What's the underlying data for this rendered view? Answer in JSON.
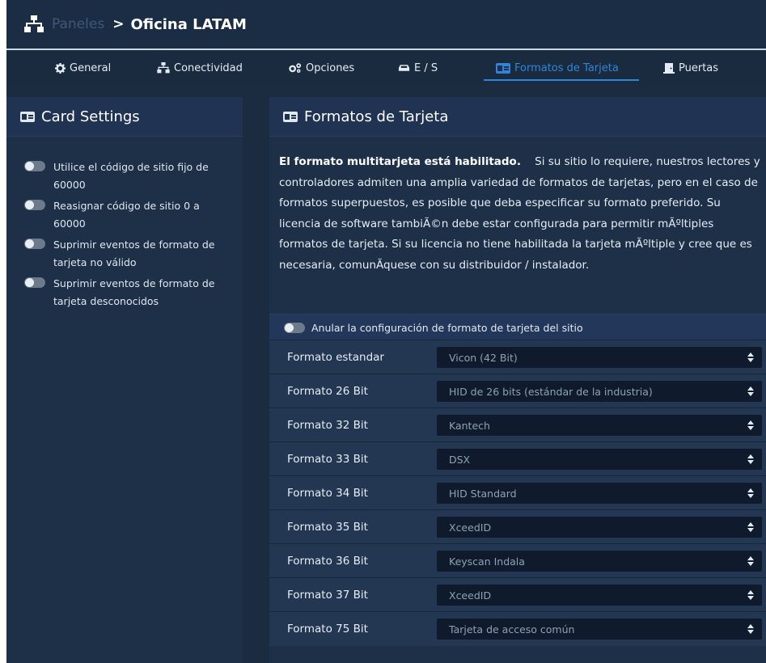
{
  "breadcrumb": {
    "parent": "Paneles",
    "separator": ">",
    "current": "Oficina LATAM"
  },
  "tabs": [
    {
      "label": "General",
      "icon": "gear-icon",
      "active": false
    },
    {
      "label": "Conectividad",
      "icon": "network-icon",
      "active": false
    },
    {
      "label": "Opciones",
      "icon": "gears-icon",
      "active": false
    },
    {
      "label": "E / S",
      "icon": "car-icon",
      "active": false
    },
    {
      "label": "Formatos de Tarjeta",
      "icon": "id-card-icon",
      "active": true
    },
    {
      "label": "Puertas",
      "icon": "door-icon",
      "active": false
    }
  ],
  "card_settings": {
    "title": "Card Settings",
    "options": [
      {
        "label": "Utilice el código de sitio fijo de 60000",
        "enabled": false
      },
      {
        "label": "Reasignar código de sitio 0 a 60000",
        "enabled": false
      },
      {
        "label": "Suprimir eventos de formato de tarjeta no válido",
        "enabled": false
      },
      {
        "label": "Suprimir eventos de formato de tarjeta desconocidos",
        "enabled": false
      }
    ]
  },
  "formats": {
    "title": "Formatos de Tarjeta",
    "description_bold": "El formato multitarjeta está habilitado.",
    "description": "Si su sitio lo requiere, nuestros lectores y controladores admiten una amplia variedad de formatos de tarjetas, pero en el caso de formatos superpuestos, es posible que deba especificar su formato preferido. Su licencia de software tambiÃ©n debe estar configurada para permitir mÃºltiples formatos de tarjeta. Si su licencia no tiene habilitada la tarjeta mÃºltiple y cree que es necesaria, comunÃquese con su distribuidor / instalador.",
    "override_label": "Anular la configuración de formato de tarjeta del sitio",
    "rows": [
      {
        "label": "Formato estandar",
        "value": "Vicon (42 Bit)"
      },
      {
        "label": "Formato 26 Bit",
        "value": "HID de 26 bits (estándar de la industria)"
      },
      {
        "label": "Formato 32 Bit",
        "value": "Kantech"
      },
      {
        "label": "Formato 33 Bit",
        "value": "DSX"
      },
      {
        "label": "Formato 34 Bit",
        "value": "HID Standard"
      },
      {
        "label": "Formato 35 Bit",
        "value": "XceedID"
      },
      {
        "label": "Formato 36 Bit",
        "value": "Keyscan Indala"
      },
      {
        "label": "Formato 37 Bit",
        "value": "XceedID"
      },
      {
        "label": "Formato 75 Bit",
        "value": "Tarjeta de acceso común"
      }
    ]
  }
}
